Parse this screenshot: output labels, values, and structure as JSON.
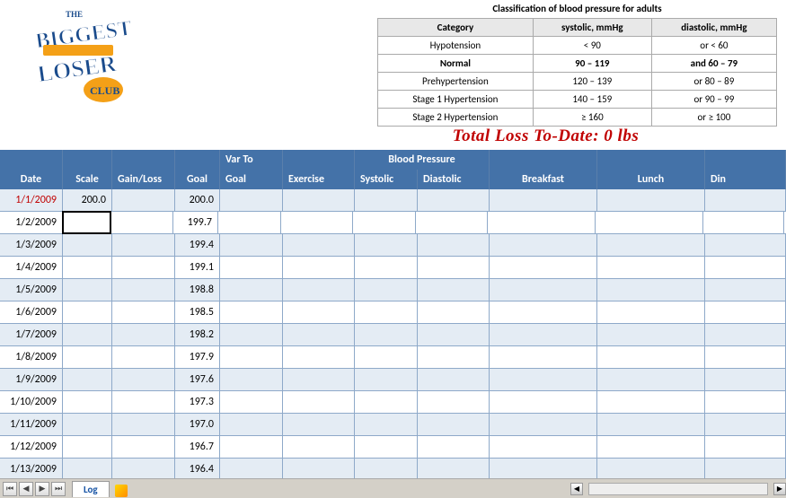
{
  "logo": {
    "line1": "THE",
    "line2": "BIGGEST",
    "line3": "LOSER",
    "line4": "CLUB"
  },
  "bp": {
    "title": "Classification of blood pressure for adults",
    "headers": [
      "Category",
      "systolic, mmHg",
      "diastolic, mmHg"
    ],
    "rows": [
      [
        "Hypotension",
        "< 90",
        "or < 60"
      ],
      [
        "Normal",
        "90 – 119",
        "and 60 – 79"
      ],
      [
        "Prehypertension",
        "120 – 139",
        "or 80 – 89"
      ],
      [
        "Stage 1 Hypertension",
        "140 – 159",
        "or 90 – 99"
      ],
      [
        "Stage 2 Hypertension",
        "≥ 160",
        "or ≥ 100"
      ]
    ]
  },
  "total_loss": "Total Loss To-Date: 0 lbs",
  "headers": {
    "top": {
      "var_to": "Var To",
      "blood_pressure": "Blood Pressure"
    },
    "main": {
      "date": "Date",
      "scale": "Scale",
      "gain_loss": "Gain/Loss",
      "goal": "Goal",
      "goal2": "Goal",
      "exercise": "Exercise",
      "systolic": "Systolic",
      "diastolic": "Diastolic",
      "breakfast": "Breakfast",
      "lunch": "Lunch",
      "dinner": "Din"
    }
  },
  "rows": [
    {
      "date": "1/1/2009",
      "date_red": true,
      "scale": "200.0",
      "goal": "200.0"
    },
    {
      "date": "1/2/2009",
      "selected": true,
      "goal": "199.7"
    },
    {
      "date": "1/3/2009",
      "goal": "199.4"
    },
    {
      "date": "1/4/2009",
      "goal": "199.1"
    },
    {
      "date": "1/5/2009",
      "goal": "198.8"
    },
    {
      "date": "1/6/2009",
      "goal": "198.5"
    },
    {
      "date": "1/7/2009",
      "goal": "198.2"
    },
    {
      "date": "1/8/2009",
      "goal": "197.9"
    },
    {
      "date": "1/9/2009",
      "goal": "197.6"
    },
    {
      "date": "1/10/2009",
      "goal": "197.3"
    },
    {
      "date": "1/11/2009",
      "goal": "197.0"
    },
    {
      "date": "1/12/2009",
      "goal": "196.7"
    },
    {
      "date": "1/13/2009",
      "goal": "196.4"
    }
  ],
  "tabs": {
    "log": "Log"
  },
  "nav": {
    "first": "⏮",
    "prev": "◀",
    "next": "▶",
    "last": "⏭"
  }
}
